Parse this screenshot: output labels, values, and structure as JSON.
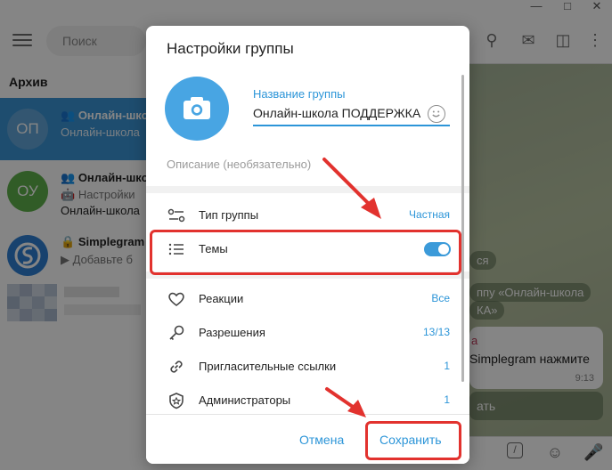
{
  "sidebar": {
    "search_placeholder": "Поиск",
    "archive_label": "Архив",
    "chats": [
      {
        "avatar_text": "ОП",
        "title": "Онлайн-шко",
        "sub": "Онлайн-школа",
        "color": "#62a5d8"
      },
      {
        "avatar_text": "ОУ",
        "title": "Онлайн-шко",
        "sub": "Настройки",
        "sub2": "Онлайн-школа",
        "color": "#5fb14b"
      },
      {
        "avatar_text": "S",
        "title": "Simplegram",
        "sub": "Добавьте б",
        "color": "#2f7fd3"
      }
    ]
  },
  "chat_view": {
    "bubbles": [
      "ся",
      "ппу «Онлайн-школа",
      "КА»"
    ],
    "message": {
      "sender": "a",
      "text": "Simplegram нажмите",
      "time": "9:13"
    },
    "action": "ать"
  },
  "modal": {
    "title": "Настройки группы",
    "name_label": "Название группы",
    "name_value": "Онлайн-школа ПОДДЕРЖКА",
    "description_placeholder": "Описание (необязательно)",
    "rows": [
      {
        "icon": "group-type-icon",
        "label": "Тип группы",
        "value": "Частная"
      },
      {
        "icon": "topics-icon",
        "label": "Темы",
        "toggle": true
      },
      {
        "icon": "heart-icon",
        "label": "Реакции",
        "value": "Все"
      },
      {
        "icon": "key-icon",
        "label": "Разрешения",
        "value": "13/13"
      },
      {
        "icon": "link-icon",
        "label": "Пригласительные ссылки",
        "value": "1"
      },
      {
        "icon": "admin-icon",
        "label": "Администраторы",
        "value": "1"
      }
    ],
    "cancel_label": "Отмена",
    "save_label": "Сохранить"
  },
  "colors": {
    "accent": "#2c95d8",
    "highlight": "#e2322e"
  }
}
